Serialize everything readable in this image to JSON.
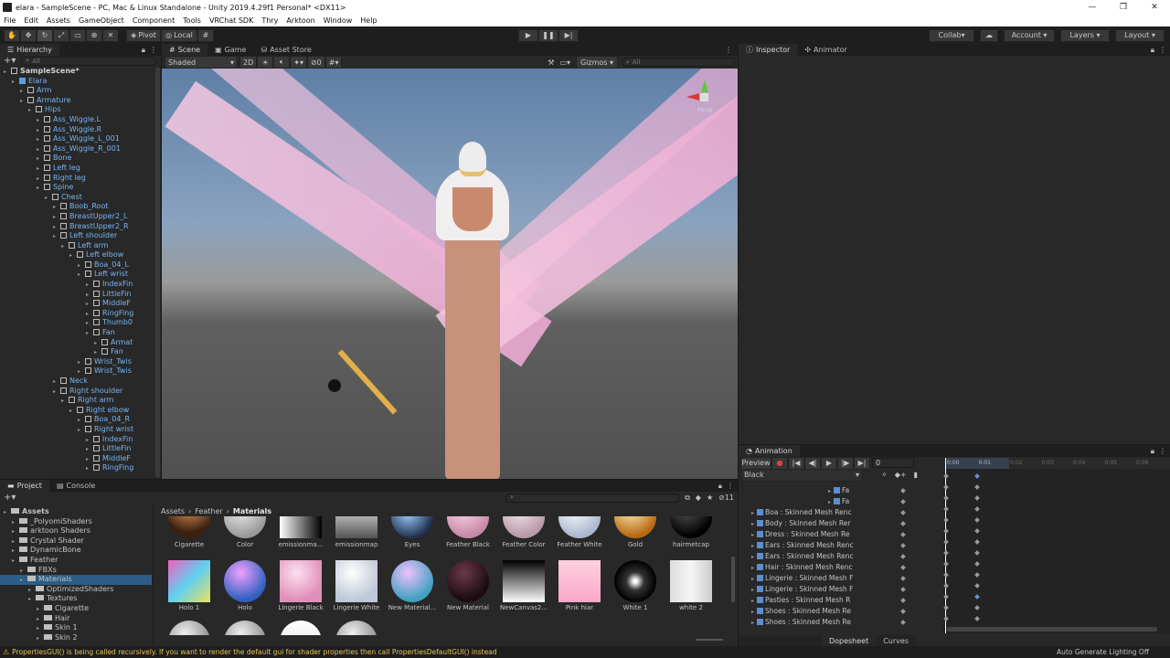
{
  "window": {
    "title": "elara - SampleScene - PC, Mac & Linux Standalone - Unity 2019.4.29f1 Personal* <DX11>",
    "controls": [
      "—",
      "❐",
      "✕"
    ]
  },
  "menu": [
    "File",
    "Edit",
    "Assets",
    "GameObject",
    "Component",
    "Tools",
    "VRChat SDK",
    "Thry",
    "Arktoon",
    "Window",
    "Help"
  ],
  "toolbar": {
    "pivot": "Pivot",
    "local": "Local",
    "collab": "Collab",
    "account": "Account",
    "layers": "Layers",
    "layout": "Layout"
  },
  "hierarchy": {
    "tab": "Hierarchy",
    "search_placeholder": "All",
    "items": [
      {
        "label": "SampleScene*",
        "depth": 0,
        "type": "scene"
      },
      {
        "label": "Elara",
        "depth": 1,
        "type": "root"
      },
      {
        "label": "Arm",
        "depth": 2
      },
      {
        "label": "Armature",
        "depth": 2
      },
      {
        "label": "Hips",
        "depth": 3
      },
      {
        "label": "Ass_Wiggle.L",
        "depth": 4
      },
      {
        "label": "Ass_Wiggle.R",
        "depth": 4
      },
      {
        "label": "Ass_Wiggle_L_001",
        "depth": 4
      },
      {
        "label": "Ass_Wiggle_R_001",
        "depth": 4
      },
      {
        "label": "Bone",
        "depth": 4
      },
      {
        "label": "Left leg",
        "depth": 4
      },
      {
        "label": "Right leg",
        "depth": 4
      },
      {
        "label": "Spine",
        "depth": 4
      },
      {
        "label": "Chest",
        "depth": 5
      },
      {
        "label": "Boob_Root",
        "depth": 6
      },
      {
        "label": "BreastUpper2_L",
        "depth": 6
      },
      {
        "label": "BreastUpper2_R",
        "depth": 6
      },
      {
        "label": "Left shoulder",
        "depth": 6
      },
      {
        "label": "Left arm",
        "depth": 7
      },
      {
        "label": "Left elbow",
        "depth": 8
      },
      {
        "label": "Boa_04_L",
        "depth": 9
      },
      {
        "label": "Left wrist",
        "depth": 9
      },
      {
        "label": "IndexFin",
        "depth": 10
      },
      {
        "label": "LittleFin",
        "depth": 10
      },
      {
        "label": "MiddleF",
        "depth": 10
      },
      {
        "label": "RingFing",
        "depth": 10
      },
      {
        "label": "Thumb0",
        "depth": 10
      },
      {
        "label": "Fan",
        "depth": 10
      },
      {
        "label": "Armat",
        "depth": 11
      },
      {
        "label": "Fan",
        "depth": 11
      },
      {
        "label": "Wrist_Twis",
        "depth": 9
      },
      {
        "label": "Wrist_Twis",
        "depth": 9
      },
      {
        "label": "Neck",
        "depth": 6
      },
      {
        "label": "Right shoulder",
        "depth": 6
      },
      {
        "label": "Right arm",
        "depth": 7
      },
      {
        "label": "Right elbow",
        "depth": 8
      },
      {
        "label": "Boa_04_R",
        "depth": 9
      },
      {
        "label": "Right wrist",
        "depth": 9
      },
      {
        "label": "IndexFin",
        "depth": 10
      },
      {
        "label": "LittleFin",
        "depth": 10
      },
      {
        "label": "MiddleF",
        "depth": 10
      },
      {
        "label": "RingFing",
        "depth": 10
      }
    ]
  },
  "scene": {
    "tabs": [
      "Scene",
      "Game",
      "Asset Store"
    ],
    "shading": "Shaded",
    "mode2d": "2D",
    "gizmos": "Gizmos",
    "search_placeholder": "All",
    "hidden_count": "0",
    "persp": "Persp"
  },
  "inspector": {
    "tabs": [
      "Inspector",
      "Animator"
    ]
  },
  "animation": {
    "tab": "Animation",
    "preview": "Preview",
    "frame": "0",
    "clip": "Black",
    "times": [
      "0:00",
      "0:01",
      "0:02",
      "0:03",
      "0:04",
      "0:05",
      "0:06"
    ],
    "properties": [
      "Fa",
      "Fa",
      "Boa : Skinned Mesh Renc",
      "Body : Skinned Mesh Rer",
      "Dress : Skinned Mesh Re",
      "Ears : Skinned Mesh Renc",
      "Ears : Skinned Mesh Renc",
      "Hair : Skinned Mesh Renc",
      "Lingerie : Skinned Mesh F",
      "Lingerie : Skinned Mesh F",
      "Pasties : Skinned Mesh R",
      "Shoes : Skinned Mesh Re",
      "Shoes : Skinned Mesh Re"
    ],
    "bottom_tabs": [
      "Dopesheet",
      "Curves"
    ]
  },
  "project": {
    "tabs": [
      "Project",
      "Console"
    ],
    "breadcrumb": [
      "Assets",
      "Feather",
      "Materials"
    ],
    "hidden_count": "11",
    "tree": [
      {
        "label": "Assets",
        "depth": 0,
        "bold": true
      },
      {
        "label": "_PolyomiShaders",
        "depth": 1
      },
      {
        "label": "arktoon Shaders",
        "depth": 1
      },
      {
        "label": "Crystal Shader",
        "depth": 1
      },
      {
        "label": "DynamicBone",
        "depth": 1
      },
      {
        "label": "Feather",
        "depth": 1
      },
      {
        "label": "FBXs",
        "depth": 2
      },
      {
        "label": "Materials",
        "depth": 2,
        "selected": true
      },
      {
        "label": "OptimizedShaders",
        "depth": 3
      },
      {
        "label": "Textures",
        "depth": 3
      },
      {
        "label": "Cigarette",
        "depth": 4
      },
      {
        "label": "Hair",
        "depth": 4
      },
      {
        "label": "Skin 1",
        "depth": 4
      },
      {
        "label": "Skin 2",
        "depth": 4
      }
    ],
    "materials_row1": [
      "Cigarette",
      "Color",
      "emissionma...",
      "emissionmap",
      "Eyes",
      "Feather Black",
      "Feather Color",
      "Feather White",
      "Gold",
      "hairmetcap"
    ],
    "materials_row2": [
      "Holo 1",
      "Holo",
      "Lingerie Black",
      "Lingerie White",
      "New Material...",
      "New Material",
      "NewCanvas2...",
      "Pink hiar",
      "White 1",
      "white 2"
    ]
  },
  "status": {
    "message": "PropertiesGUI() is being called recursively. If you want to render the default gui for shader properties then call PropertiesDefaultGUI() instead",
    "right": "Auto Generate Lighting Off"
  }
}
